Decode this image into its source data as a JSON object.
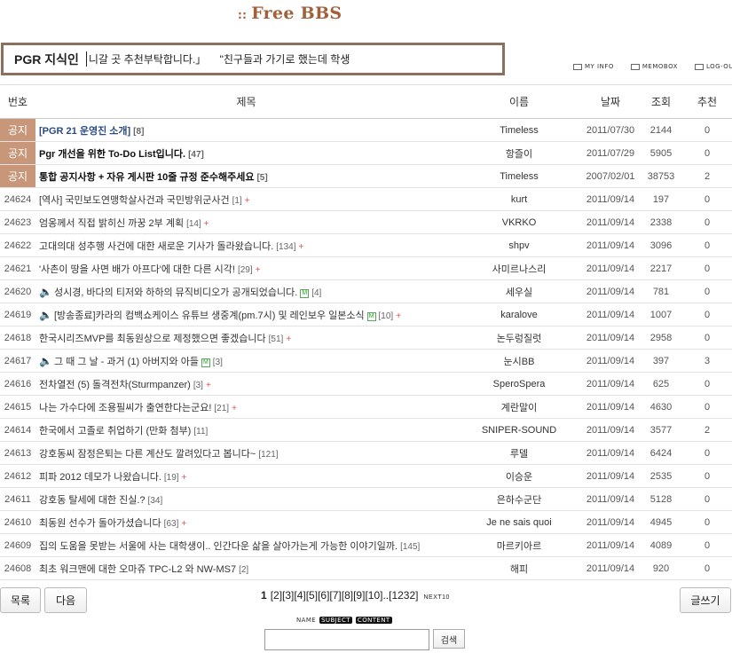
{
  "header": {
    "title_prefix": "::",
    "title": "Free BBS"
  },
  "ticker": {
    "label": "PGR 지식인",
    "items": [
      "니갈 곳 추천부탁합니다.」",
      "\"친구들과 가기로 했는데 학생"
    ]
  },
  "top_links": [
    {
      "label": "MY INFO",
      "icon": "user-info-icon"
    },
    {
      "label": "MEMOBOX",
      "icon": "memo-icon"
    },
    {
      "label": "LOG-OUT",
      "icon": "logout-icon"
    }
  ],
  "columns": {
    "no": "번호",
    "subject": "제목",
    "name": "이름",
    "date": "날짜",
    "views": "조회",
    "rec": "추천"
  },
  "posts": [
    {
      "no": "공지",
      "subject": "[PGR 21 운영진 소개]",
      "comments": "[8]",
      "name": "Timeless",
      "date": "2011/07/30",
      "views": "2144",
      "rec": "0"
    },
    {
      "no": "공지",
      "subject": "Pgr 개선을 위한 To-Do List입니다.",
      "comments": "[47]",
      "name": "항즐이",
      "date": "2011/07/29",
      "views": "5905",
      "rec": "0"
    },
    {
      "no": "공지",
      "subject": "통합 공지사항 + 자유 게시판 10줄 규정 준수해주세요",
      "comments": "[5]",
      "name": "Timeless",
      "date": "2007/02/01",
      "views": "38753",
      "rec": "2"
    },
    {
      "no": "24624",
      "subject": "[역사] 국민보도연맹학살사건과 국민방위군사건",
      "comments": "[1]",
      "plus": "+",
      "name": "kurt",
      "date": "2011/09/14",
      "views": "197",
      "rec": "0"
    },
    {
      "no": "24623",
      "subject": "엄옹께서 직접 밝히신 까꿍 2부 계획",
      "comments": "[14]",
      "plus": "+",
      "name": "VKRKO",
      "date": "2011/09/14",
      "views": "2338",
      "rec": "0"
    },
    {
      "no": "24622",
      "subject": "고대의대 성추행 사건에 대한 새로운 기사가 돌라왔습니다.",
      "comments": "[134]",
      "plus": "+",
      "name": "shpv",
      "date": "2011/09/14",
      "views": "3096",
      "rec": "0"
    },
    {
      "no": "24621",
      "subject": "'사촌이 땅을 사면 배가 아프다'에 대한 다른 시각!",
      "comments": "[29]",
      "plus": "+",
      "name": "사미르나스리",
      "date": "2011/09/14",
      "views": "2217",
      "rec": "0"
    },
    {
      "no": "24620",
      "subject": "성시경, 바다의 티저와 하하의 뮤직비디오가 공개되었습니다.",
      "speaker": "🔈",
      "m": "M",
      "comments": "[4]",
      "name": "세우실",
      "date": "2011/09/14",
      "views": "781",
      "rec": "0"
    },
    {
      "no": "24619",
      "subject": "[방송종료]카라의 컴백쇼케이스 유튜브 생중계(pm.7시) 및 레인보우 일본소식",
      "speaker": "🔈",
      "m": "M",
      "comments": "[10]",
      "plus": "+",
      "name": "karalove",
      "date": "2011/09/14",
      "views": "1007",
      "rec": "0"
    },
    {
      "no": "24618",
      "subject": "한국시리즈MVP를 최동원상으로 제정했으면 좋겠습니다",
      "comments": "[51]",
      "plus": "+",
      "name": "논두렁질럿",
      "date": "2011/09/14",
      "views": "2958",
      "rec": "0"
    },
    {
      "no": "24617",
      "subject": "그 때 그 날 - 과거 (1) 아버지와 아들",
      "speaker": "🔈",
      "m": "M",
      "comments": "[3]",
      "name": "눈시BB",
      "date": "2011/09/14",
      "views": "397",
      "rec": "3"
    },
    {
      "no": "24616",
      "subject": "전차열전 (5) 돌격전차(Sturmpanzer)",
      "comments": "[3]",
      "plus": "+",
      "name": "SperoSpera",
      "date": "2011/09/14",
      "views": "625",
      "rec": "0"
    },
    {
      "no": "24615",
      "subject": "나는 가수다에 조용필씨가 출연한다는군요!",
      "comments": "[21]",
      "plus": "+",
      "name": "계란말이",
      "date": "2011/09/14",
      "views": "4630",
      "rec": "0"
    },
    {
      "no": "24614",
      "subject": "한국에서 고졸로 취업하기 (만화 첨부)",
      "comments": "[11]",
      "name": "SNIPER-SOUND",
      "date": "2011/09/14",
      "views": "3577",
      "rec": "2"
    },
    {
      "no": "24613",
      "subject": "강호동씨 잠정은퇴는 다른 계산도 깔려있다고 봅니다~",
      "comments": "[121]",
      "name": "루델",
      "date": "2011/09/14",
      "views": "6424",
      "rec": "0"
    },
    {
      "no": "24612",
      "subject": "피파 2012 데모가 나왔습니다.",
      "comments": "[19]",
      "plus": "+",
      "name": "이승운",
      "date": "2011/09/14",
      "views": "2535",
      "rec": "0"
    },
    {
      "no": "24611",
      "subject": "강호동 탈세에 대한 진실.?",
      "comments": "[34]",
      "name": "은하수군단",
      "date": "2011/09/14",
      "views": "5128",
      "rec": "0"
    },
    {
      "no": "24610",
      "subject": "최동원 선수가 돌아가셨습니다",
      "comments": "[63]",
      "plus": "+",
      "name": "Je ne sais quoi",
      "date": "2011/09/14",
      "views": "4945",
      "rec": "0"
    },
    {
      "no": "24609",
      "subject": "집의 도움을 못받는 서울에 사는 대학생이.. 인간다운 삶을 살아가는게 가능한 이야기일까.",
      "comments": "[145]",
      "name": "마르키아르",
      "date": "2011/09/14",
      "views": "4089",
      "rec": "0"
    },
    {
      "no": "24608",
      "subject": "최초 워크맨에 대한 오마쥬 TPC-L2 와 NW-MS7",
      "comments": "[2]",
      "name": "해피",
      "date": "2011/09/14",
      "views": "920",
      "rec": "0"
    }
  ],
  "buttons": {
    "list": "목록",
    "next": "다음",
    "write": "글쓰기"
  },
  "pager": {
    "current": "1",
    "pages": [
      "[2]",
      "[3]",
      "[4]",
      "[5]",
      "[6]",
      "[7]",
      "[8]",
      "[9]",
      "[10]",
      "..[1232]"
    ],
    "next_label": "NEXT10"
  },
  "search": {
    "options": [
      "NAME",
      "SUBJECT",
      "CONTENT"
    ],
    "selected": [
      "SUBJECT",
      "CONTENT"
    ],
    "button": "검색",
    "query": ""
  },
  "colors": {
    "notice_bg": "#c8977a",
    "title": "#a0603a",
    "ticker_border": "#8b7060",
    "plus": "#e05050"
  }
}
